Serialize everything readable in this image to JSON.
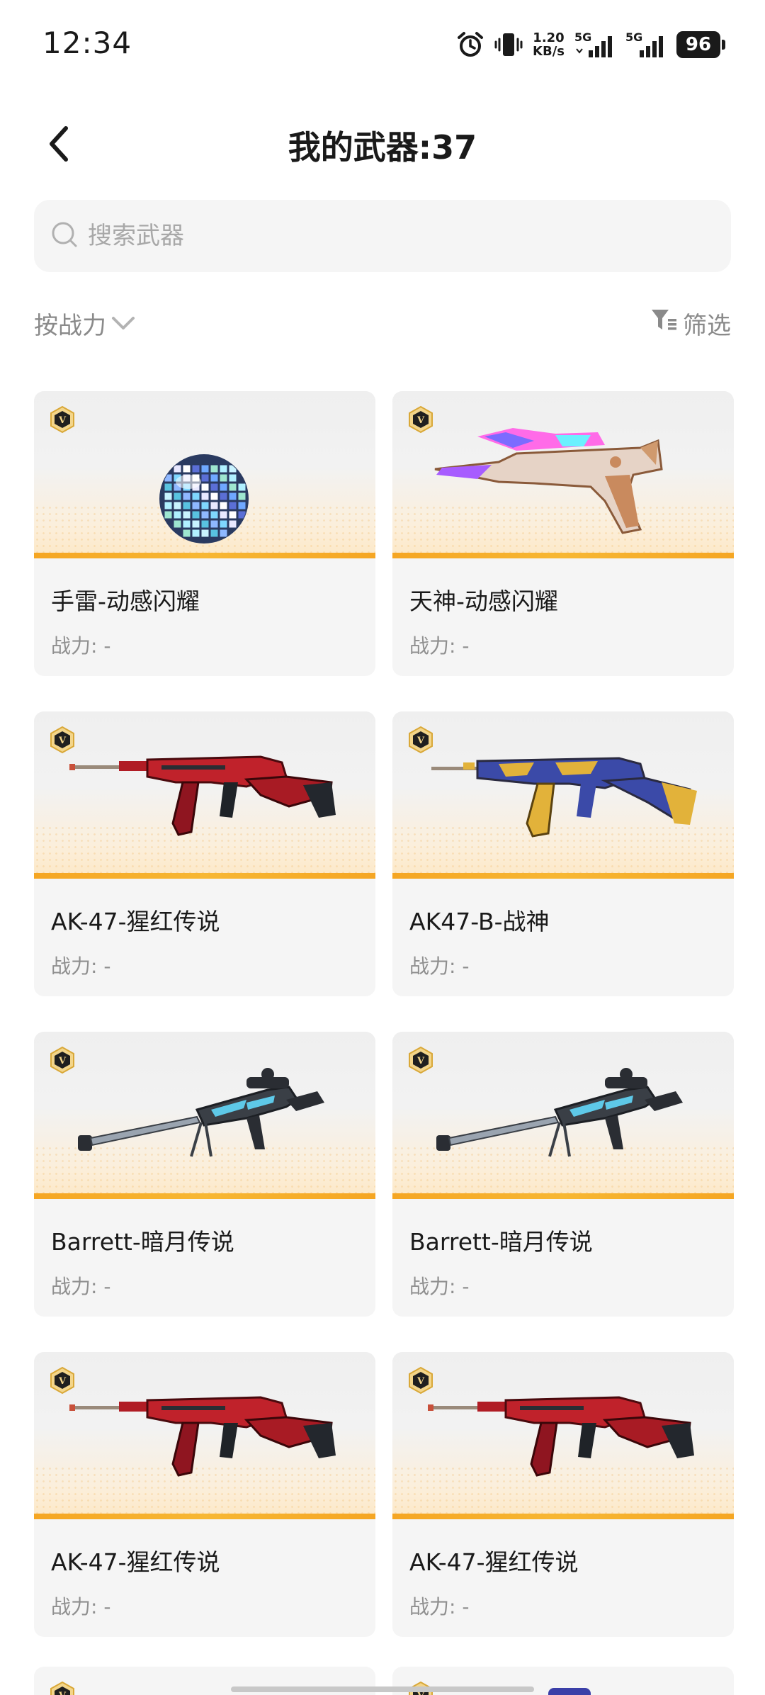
{
  "status_bar": {
    "time": "12:34",
    "net_speed_value": "1.20",
    "net_speed_unit": "KB/s",
    "signal1_label": "5G",
    "signal2_label": "5G",
    "battery": "96",
    "icons": [
      "alarm-icon",
      "vibrate-icon",
      "signal-icon",
      "battery-icon"
    ]
  },
  "header": {
    "title": "我的武器:37"
  },
  "search": {
    "placeholder": "搜索武器",
    "value": ""
  },
  "toolbar": {
    "sort_label": "按战力",
    "filter_label": "筛选"
  },
  "weapons": [
    {
      "name": "手雷-动感闪耀",
      "power": "战力: -",
      "icon": "disco-grenade"
    },
    {
      "name": "天神-动感闪耀",
      "power": "战力: -",
      "icon": "desert-eagle-pistol"
    },
    {
      "name": "AK-47-猩红传说",
      "power": "战力: -",
      "icon": "red-ak47"
    },
    {
      "name": "AK47-B-战神",
      "power": "战力: -",
      "icon": "gold-ak47"
    },
    {
      "name": "Barrett-暗月传说",
      "power": "战力: -",
      "icon": "barrett-sniper"
    },
    {
      "name": "Barrett-暗月传说",
      "power": "战力: -",
      "icon": "barrett-sniper"
    },
    {
      "name": "AK-47-猩红传说",
      "power": "战力: -",
      "icon": "red-ak47"
    },
    {
      "name": "AK-47-猩红传说",
      "power": "战力: -",
      "icon": "red-ak47"
    }
  ],
  "badge_letter": "V",
  "colors": {
    "accent_bar": "#f5a623",
    "card_bg": "#f5f5f5",
    "muted_text": "#8f8f8f"
  }
}
